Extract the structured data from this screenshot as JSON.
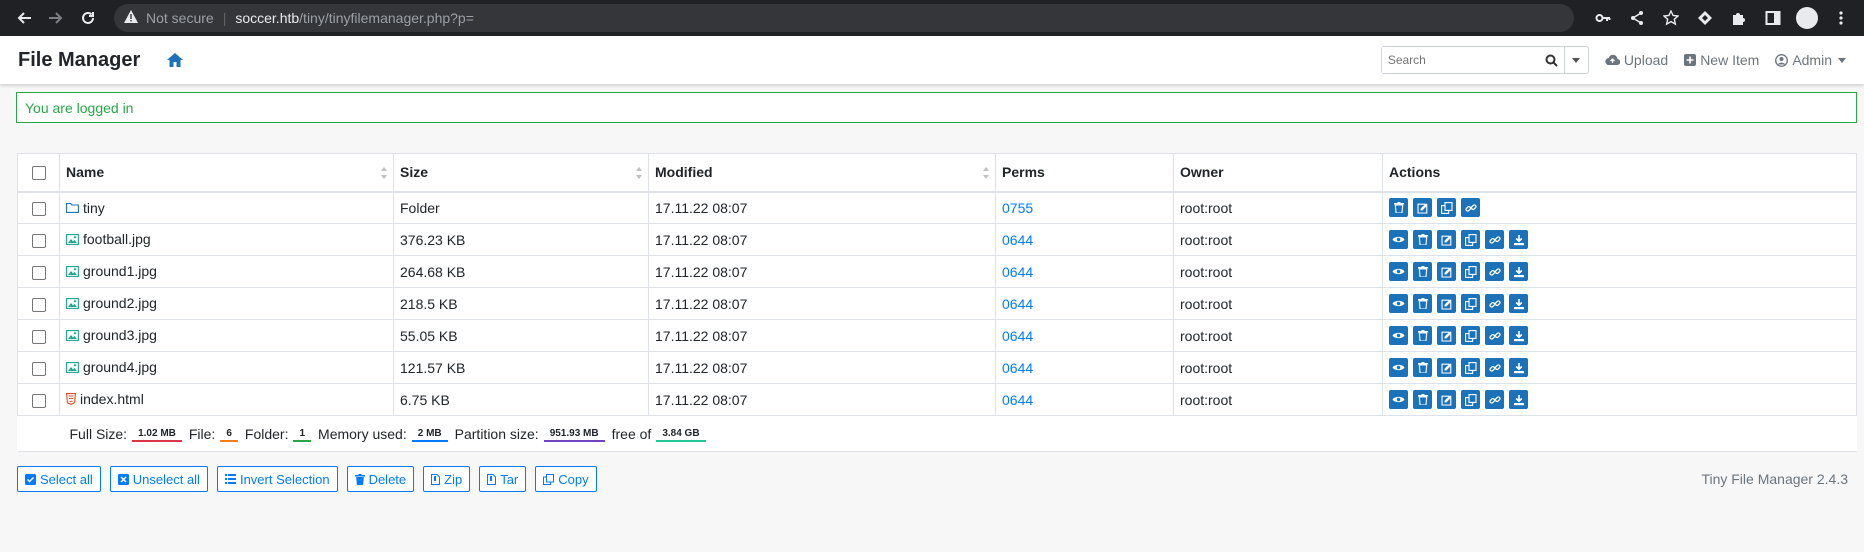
{
  "browser": {
    "not_secure": "Not secure",
    "url_host": "soccer.htb",
    "url_path": "/tiny/tinyfilemanager.php?p="
  },
  "navbar": {
    "brand": "File Manager",
    "search_placeholder": "Search",
    "upload": "Upload",
    "new_item": "New Item",
    "admin": "Admin"
  },
  "alert": "You are logged in",
  "table": {
    "headers": [
      "Name",
      "Size",
      "Modified",
      "Perms",
      "Owner",
      "Actions"
    ],
    "rows": [
      {
        "name": "tiny",
        "type": "folder",
        "size": "Folder",
        "modified": "17.11.22 08:07",
        "perms": "0755",
        "owner": "root:root"
      },
      {
        "name": "football.jpg",
        "type": "image",
        "size": "376.23 KB",
        "modified": "17.11.22 08:07",
        "perms": "0644",
        "owner": "root:root"
      },
      {
        "name": "ground1.jpg",
        "type": "image",
        "size": "264.68 KB",
        "modified": "17.11.22 08:07",
        "perms": "0644",
        "owner": "root:root"
      },
      {
        "name": "ground2.jpg",
        "type": "image",
        "size": "218.5 KB",
        "modified": "17.11.22 08:07",
        "perms": "0644",
        "owner": "root:root"
      },
      {
        "name": "ground3.jpg",
        "type": "image",
        "size": "55.05 KB",
        "modified": "17.11.22 08:07",
        "perms": "0644",
        "owner": "root:root"
      },
      {
        "name": "ground4.jpg",
        "type": "image",
        "size": "121.57 KB",
        "modified": "17.11.22 08:07",
        "perms": "0644",
        "owner": "root:root"
      },
      {
        "name": "index.html",
        "type": "html",
        "size": "6.75 KB",
        "modified": "17.11.22 08:07",
        "perms": "0644",
        "owner": "root:root"
      }
    ]
  },
  "summary": {
    "full_size_label": "Full Size:",
    "full_size": "1.02 MB",
    "file_label": "File:",
    "file_count": "6",
    "folder_label": "Folder:",
    "folder_count": "1",
    "memory_label": "Memory used:",
    "memory": "2 MB",
    "partition_label": "Partition size:",
    "partition": "951.93 MB",
    "free_label": "free of",
    "free": "3.84 GB"
  },
  "buttons": {
    "select_all": "Select all",
    "unselect_all": "Unselect all",
    "invert": "Invert Selection",
    "delete": "Delete",
    "zip": "Zip",
    "tar": "Tar",
    "copy": "Copy"
  },
  "version": "Tiny File Manager 2.4.3",
  "colors": {
    "accent": "#007bff",
    "action_button": "#1c72b8",
    "success": "#28a745",
    "badge_full_size": "#dc3545",
    "badge_file": "#fd7e14",
    "badge_folder": "#28a745",
    "badge_memory": "#007bff",
    "badge_partition": "#6f42c1",
    "badge_free": "#20c997"
  }
}
